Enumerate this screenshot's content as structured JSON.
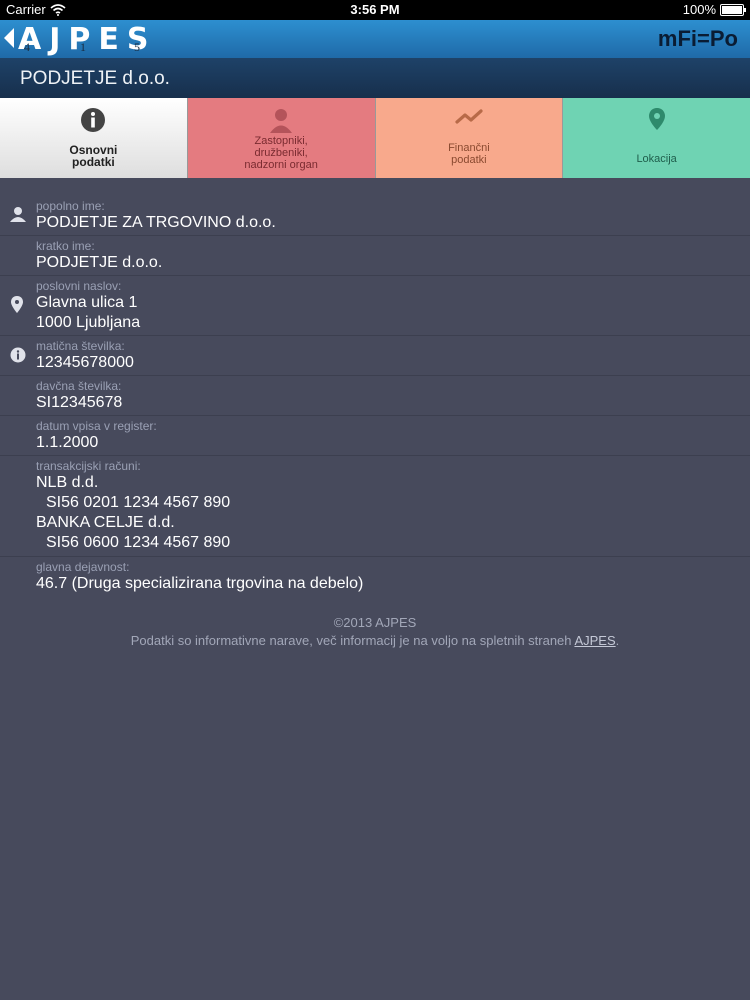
{
  "status_bar": {
    "carrier": "Carrier",
    "time": "3:56 PM",
    "battery": "100%"
  },
  "header": {
    "logo_text": "AJPES",
    "logo_numbers": [
      "4",
      "1",
      "5"
    ],
    "app_name": "mFi=Po"
  },
  "title": "PODJETJE d.o.o.",
  "tabs": [
    {
      "label": "Osnovni podatki",
      "icon": "info-icon",
      "lines": [
        "Osnovni",
        "podatki"
      ]
    },
    {
      "label": "Zastopniki, družbeniki, nadzorni organ",
      "icon": "person-icon",
      "lines": [
        "Zastopniki,",
        "družbeniki,",
        "nadzorni organ"
      ]
    },
    {
      "label": "Finančni podatki",
      "icon": "trend-icon",
      "lines": [
        "Finančni",
        "podatki"
      ]
    },
    {
      "label": "Lokacija",
      "icon": "location-pin-icon",
      "lines": [
        "Lokacija"
      ]
    }
  ],
  "details": [
    {
      "label": "popolno ime:",
      "values": [
        "PODJETJE ZA TRGOVINO d.o.o."
      ],
      "icon": "person-icon"
    },
    {
      "label": "kratko ime:",
      "values": [
        "PODJETJE d.o.o."
      ]
    },
    {
      "label": "poslovni naslov:",
      "values": [
        "Glavna ulica 1",
        "1000 Ljubljana"
      ],
      "icon": "location-pin-icon"
    },
    {
      "label": "matična številka:",
      "values": [
        "12345678000"
      ],
      "icon": "info-icon"
    },
    {
      "label": "davčna številka:",
      "values": [
        "SI12345678"
      ]
    },
    {
      "label": "datum vpisa v register:",
      "values": [
        "1.1.2000"
      ]
    },
    {
      "label": "transakcijski računi:",
      "values": [
        "NLB d.d.",
        "SI56 0201 1234 4567 890",
        "BANKA CELJE d.d.",
        "SI56 0600 1234 4567 890"
      ]
    },
    {
      "label": "glavna dejavnost:",
      "values": [
        "46.7 (Druga specializirana trgovina na debelo)"
      ]
    }
  ],
  "footer": {
    "copyright": "©2013 AJPES",
    "note": "Podatki so informativne narave, več informacij je na voljo na spletnih straneh",
    "link": "AJPES",
    "end": "."
  },
  "colors": {
    "background": "#474a5c",
    "topbar": "#2a82c4",
    "titlebar": "#1e3a5c",
    "tab_osnovni": "#ffffff",
    "tab_zastopniki": "#e47b80",
    "tab_financni": "#f8a98c",
    "tab_lokacija": "#6fd3b3"
  }
}
